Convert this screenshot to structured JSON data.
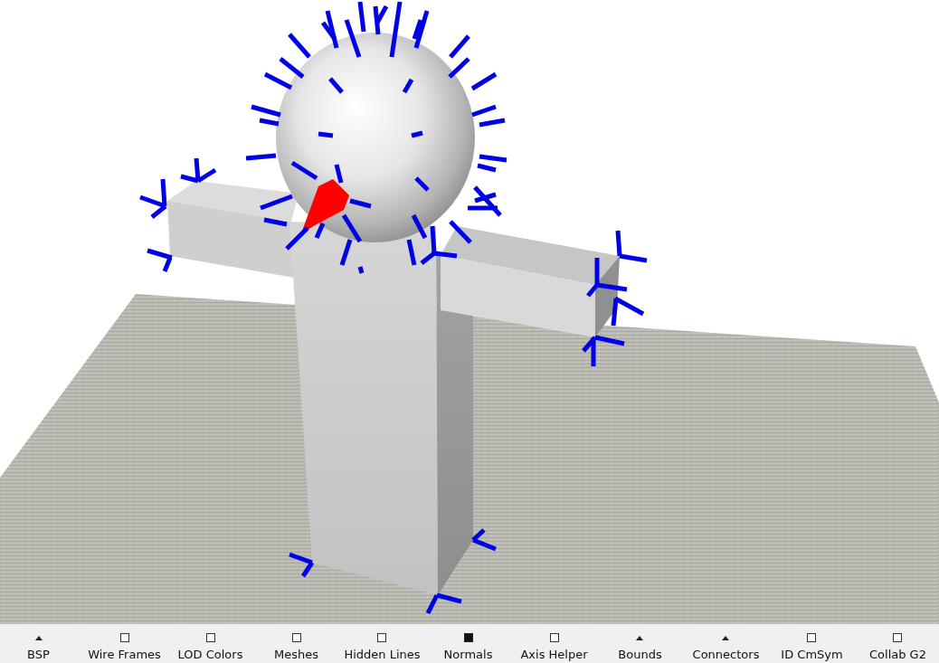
{
  "toolbar": {
    "items": [
      {
        "label": "BSP",
        "kind": "dropdown"
      },
      {
        "label": "Wire Frames",
        "kind": "checkbox",
        "checked": false
      },
      {
        "label": "LOD Colors",
        "kind": "checkbox",
        "checked": false
      },
      {
        "label": "Meshes",
        "kind": "checkbox",
        "checked": false
      },
      {
        "label": "Hidden Lines",
        "kind": "checkbox",
        "checked": false
      },
      {
        "label": "Normals",
        "kind": "checkbox",
        "checked": true
      },
      {
        "label": "Axis Helper",
        "kind": "checkbox",
        "checked": false
      },
      {
        "label": "Bounds",
        "kind": "dropdown"
      },
      {
        "label": "Connectors",
        "kind": "dropdown"
      },
      {
        "label": "ID CmSym",
        "kind": "checkbox",
        "checked": false
      },
      {
        "label": "Collab G2",
        "kind": "checkbox",
        "checked": false
      }
    ]
  }
}
